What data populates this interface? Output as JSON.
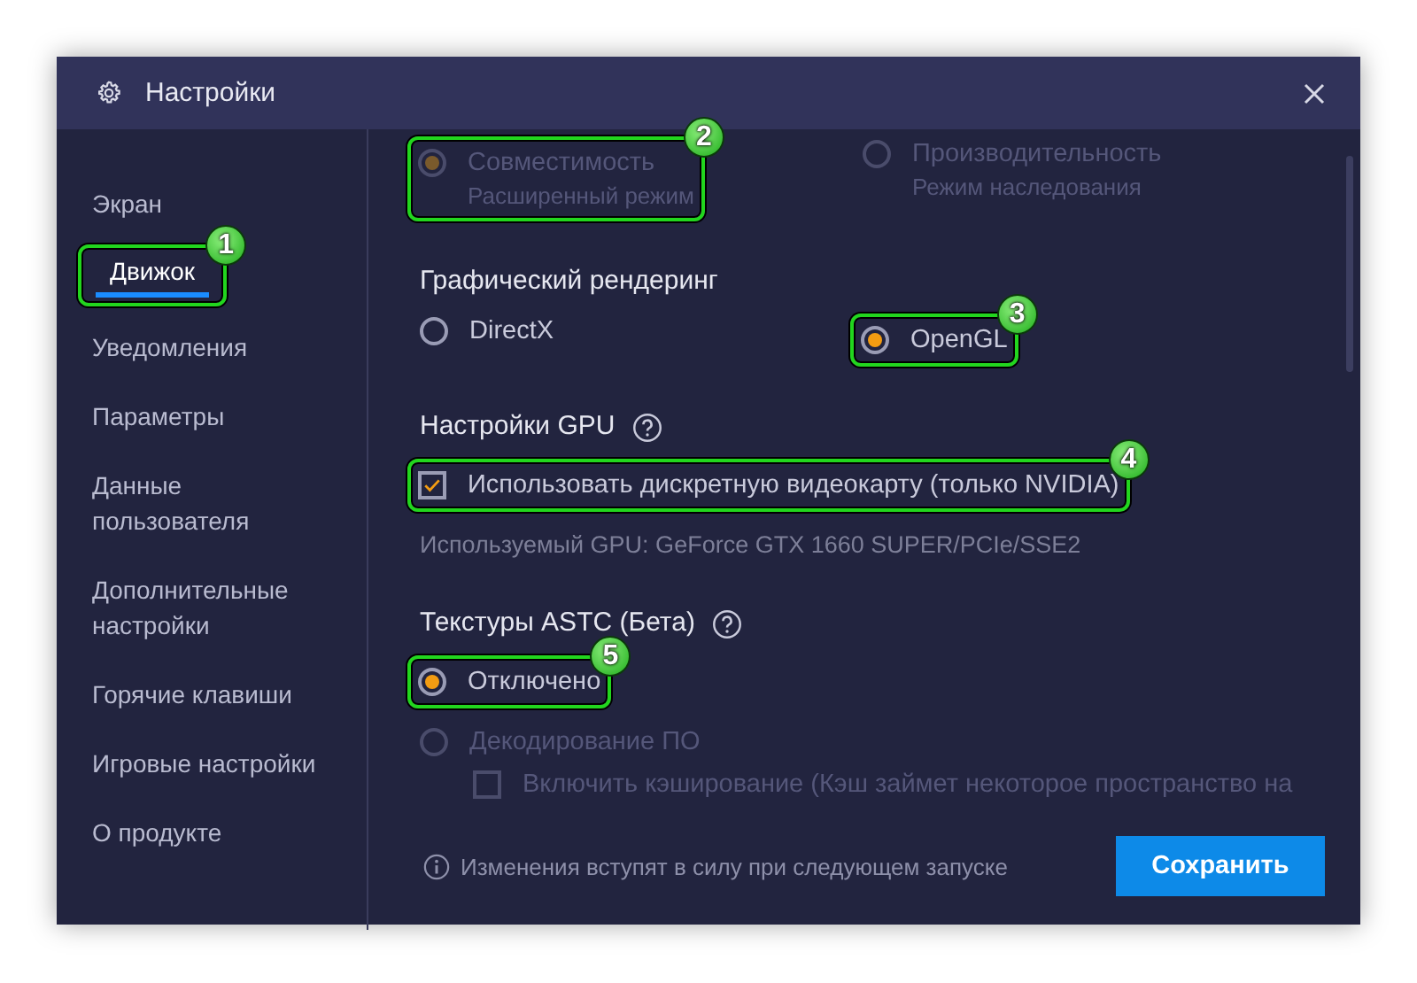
{
  "window": {
    "title": "Настройки"
  },
  "sidebar": {
    "items": [
      {
        "label": "Экран",
        "selected": false
      },
      {
        "label": "Движок",
        "selected": true,
        "callout": "1"
      },
      {
        "label": "Уведомления",
        "selected": false
      },
      {
        "label": "Параметры",
        "selected": false
      },
      {
        "label": "Данные пользователя",
        "selected": false
      },
      {
        "label": "Дополнительные настройки",
        "selected": false
      },
      {
        "label": "Горячие клавиши",
        "selected": false
      },
      {
        "label": "Игровые настройки",
        "selected": false
      },
      {
        "label": "О продукте",
        "selected": false
      }
    ]
  },
  "sections": [
    {
      "kind": "inline",
      "items": [
        {
          "kind": "radio",
          "label": "Совместимость",
          "sublabel": "Расширенный режим",
          "selected": true,
          "disabled": true,
          "callout": "2"
        },
        {
          "kind": "radio",
          "label": "Производительность",
          "sublabel": "Режим наследования",
          "selected": false,
          "disabled": true
        }
      ]
    },
    {
      "title": "Графический рендеринг",
      "kind": "inline",
      "items": [
        {
          "kind": "radio",
          "label": "DirectX",
          "selected": false,
          "disabled": false
        },
        {
          "kind": "radio",
          "label": "OpenGL",
          "selected": true,
          "disabled": false,
          "callout": "3"
        }
      ]
    },
    {
      "title": "Настройки GPU",
      "help": true,
      "kind": "stacked",
      "items": [
        {
          "kind": "checkbox",
          "label": "Использовать дискретную видеокарту (только NVIDIA)",
          "checked": true,
          "disabled": false,
          "callout": "4"
        },
        {
          "kind": "note",
          "label": "Используемый GPU: GeForce GTX 1660 SUPER/PCIe/SSE2"
        }
      ]
    },
    {
      "title": "Текстуры ASTC (Бета)",
      "help": true,
      "kind": "stacked",
      "items": [
        {
          "kind": "radio",
          "label": "Отключено",
          "selected": true,
          "disabled": false,
          "callout": "5"
        },
        {
          "kind": "radio",
          "label": "Декодирование ПО",
          "selected": false,
          "disabled": true,
          "children": [
            {
              "kind": "checkbox",
              "label": "Включить кэширование (Кэш займет некоторое пространство на",
              "checked": false,
              "disabled": true
            }
          ]
        }
      ]
    }
  ],
  "footer": {
    "info": "Изменения вступят в силу при следующем запуске",
    "button": "Сохранить"
  }
}
